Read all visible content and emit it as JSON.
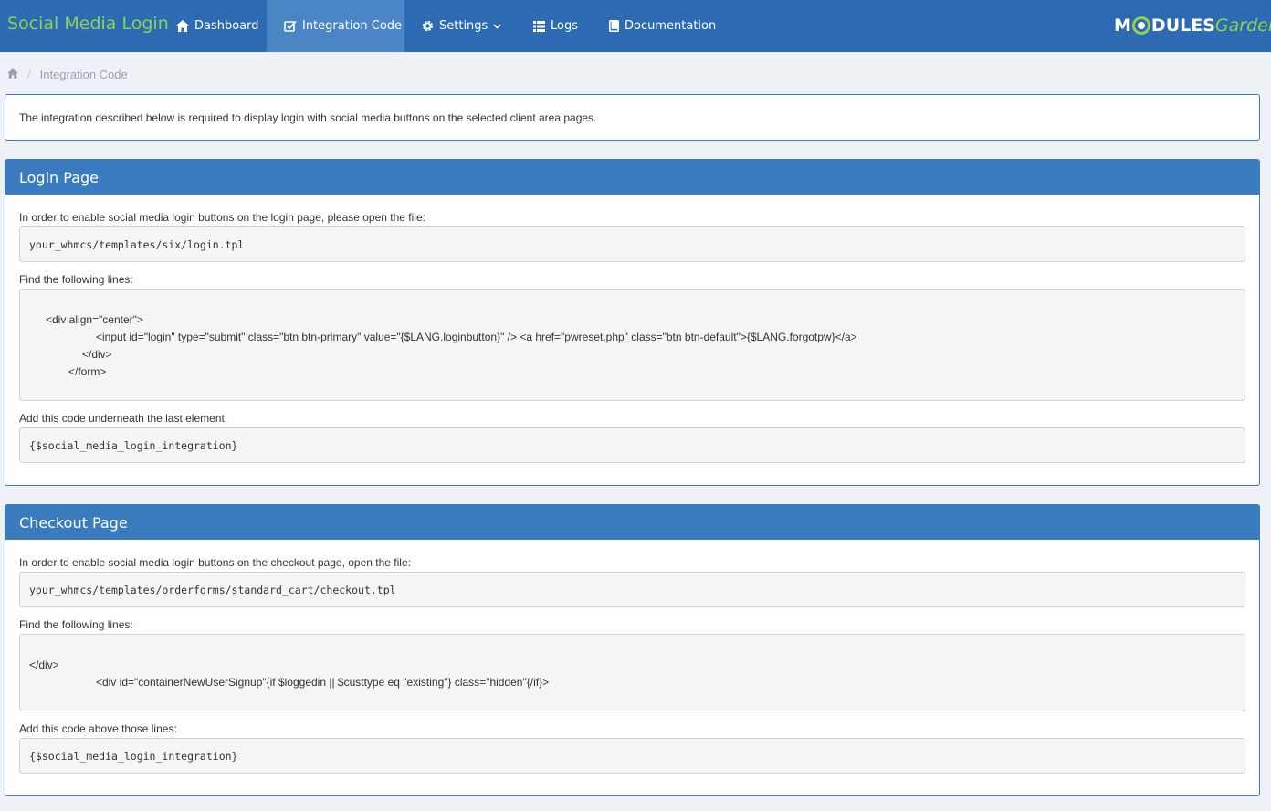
{
  "nav": {
    "brand": "Social Media Login",
    "items": [
      {
        "label": "Dashboard",
        "icon": "home-icon"
      },
      {
        "label": "Integration Code",
        "icon": "edit-square-icon"
      },
      {
        "label": "Settings",
        "icon": "gear-icon"
      },
      {
        "label": "Logs",
        "icon": "list-icon"
      },
      {
        "label": "Documentation",
        "icon": "book-icon"
      }
    ],
    "logo_part1": "M",
    "logo_part2": "DULES",
    "logo_part3": "Garden"
  },
  "breadcrumb": {
    "separator": "/",
    "current": "Integration Code"
  },
  "notice": "The integration described below is required to display login with social media buttons on the selected client area pages.",
  "login_panel": {
    "title": "Login Page",
    "intro": "In order to enable social media login buttons on the login page, please open the file:",
    "file_path": "your_whmcs/templates/six/login.tpl",
    "find_label": "Find the following lines:",
    "lines": [
      "<div align=\"center\">",
      "<input id=\"login\" type=\"submit\" class=\"btn btn-primary\" value=\"{$LANG.loginbutton}\" /> <a href=\"pwreset.php\" class=\"btn btn-default\">{$LANG.forgotpw}</a>",
      "</div>",
      "</form>"
    ],
    "add_label": "Add this code underneath the last element:",
    "code": "{$social_media_login_integration}"
  },
  "checkout_panel": {
    "title": "Checkout Page",
    "intro": "In order to enable social media login buttons on the checkout page, open the file:",
    "file_path": "your_whmcs/templates/orderforms/standard_cart/checkout.tpl",
    "find_label": "Find the following lines:",
    "lines": [
      "</div>",
      "<div id=\"containerNewUserSignup\"{if $loggedin || $custtype eq \"existing\"} class=\"hidden\"{/if}>"
    ],
    "add_label": "Add this code above those lines:",
    "code": "{$social_media_login_integration}"
  },
  "colors": {
    "nav_bg": "#2c6bb3",
    "nav_active": "#4a85c6",
    "brand": "#8fd14f",
    "panel_header": "#3a7bbf",
    "page_bg": "#eef1f5"
  }
}
